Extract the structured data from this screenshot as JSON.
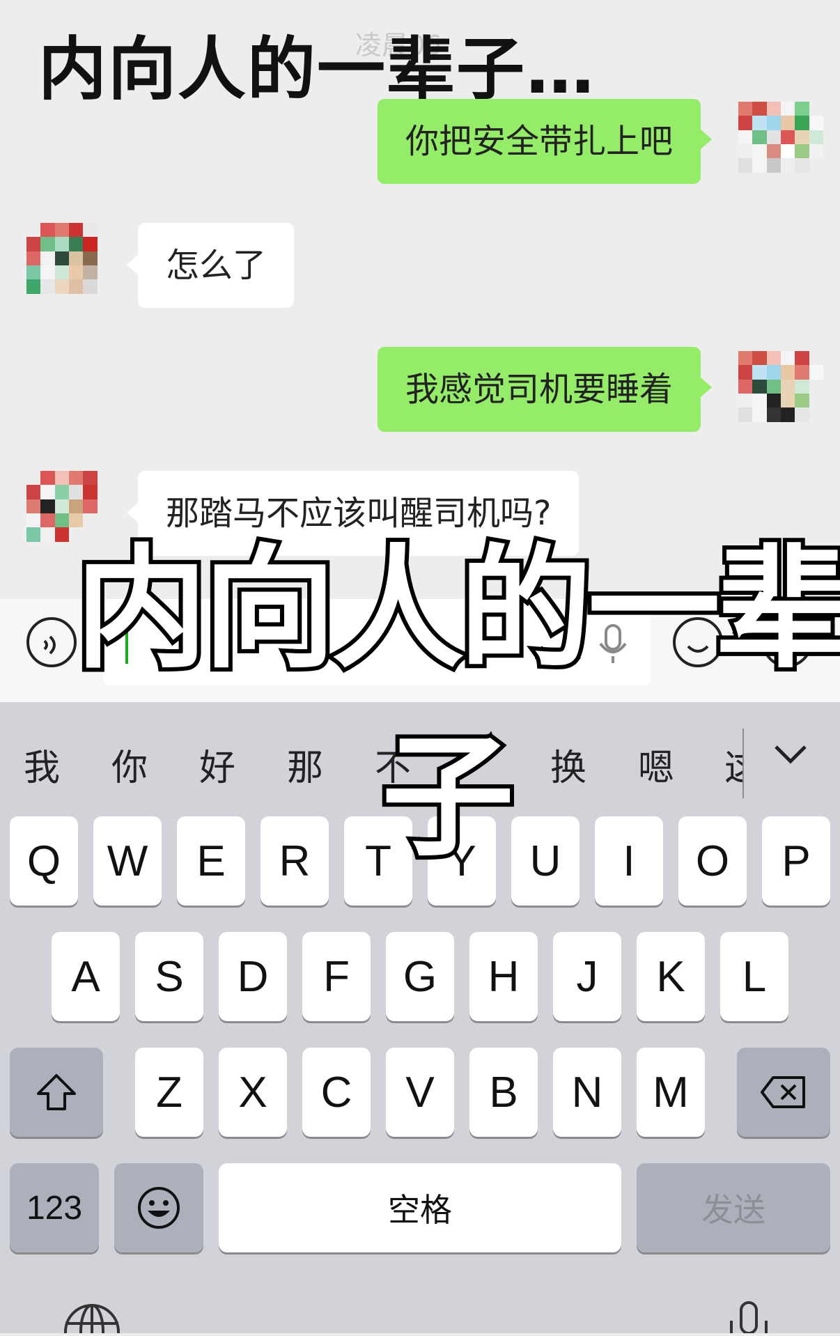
{
  "header": {
    "title": "内向人的一辈子…",
    "watermark": "凌晨06"
  },
  "messages": [
    {
      "side": "out",
      "text": "你把安全带扎上吧"
    },
    {
      "side": "in",
      "text": "怎么了"
    },
    {
      "side": "out",
      "text": "我感觉司机要睡着"
    },
    {
      "side": "in",
      "text": "那踏马不应该叫醒司机吗?"
    }
  ],
  "input_bar": {
    "voice_icon": "voice-toggle-icon",
    "mic_icon": "mic-icon",
    "emoji_icon": "emoji-icon",
    "plus_icon": "plus-icon"
  },
  "overlay": {
    "line1": "内向人的一辈",
    "line2": "子"
  },
  "keyboard": {
    "candidates": [
      "我",
      "你",
      "好",
      "那",
      "不",
      "换",
      "嗯",
      "这"
    ],
    "row1": [
      "Q",
      "W",
      "E",
      "R",
      "T",
      "Y",
      "U",
      "I",
      "O",
      "P"
    ],
    "row2": [
      "A",
      "S",
      "D",
      "F",
      "G",
      "H",
      "J",
      "K",
      "L"
    ],
    "row3": [
      "Z",
      "X",
      "C",
      "V",
      "B",
      "N",
      "M"
    ],
    "num_key": "123",
    "space_key": "空格",
    "send_key": "发送",
    "icons": [
      "shift-icon",
      "backspace-icon",
      "emoji-face-icon",
      "globe-icon",
      "dictation-mic-icon",
      "collapse-chevron-icon"
    ]
  },
  "colors": {
    "bubble_out": "#95ec69",
    "bubble_in": "#ffffff",
    "chat_bg": "#ededed",
    "keyboard_bg": "#d1d3d9",
    "key_dark": "#abb0bb"
  }
}
